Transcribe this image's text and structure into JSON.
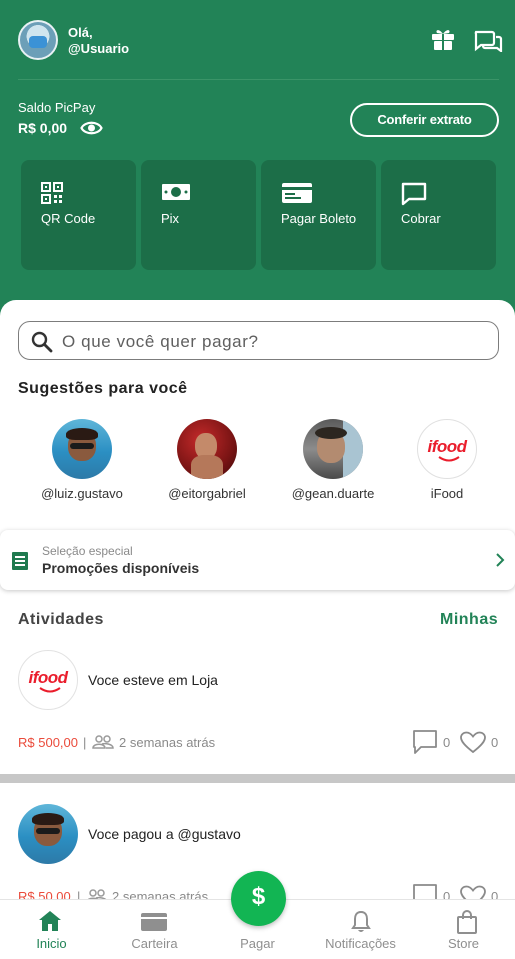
{
  "header": {
    "greeting": "Olá,",
    "username": "@Usuario",
    "balance_label": "Saldo PicPay",
    "balance_value": "R$ 0,00",
    "statement_button": "Conferir extrato",
    "icons": [
      "gift-icon",
      "chat-icon",
      "eye-icon"
    ]
  },
  "actions": [
    {
      "label": "QR Code",
      "icon": "qr-code-icon"
    },
    {
      "label": "Pix",
      "icon": "money-icon"
    },
    {
      "label": "Pagar Boleto",
      "icon": "boleto-icon"
    },
    {
      "label": "Cobrar",
      "icon": "message-icon"
    }
  ],
  "search": {
    "placeholder": "O que você quer pagar?"
  },
  "suggestions": {
    "title": "Sugestões para você",
    "items": [
      {
        "name": "@luiz.gustavo"
      },
      {
        "name": "@eitorgabriel"
      },
      {
        "name": "@gean.duarte"
      },
      {
        "name": "iFood",
        "logo_text": "ifood"
      }
    ]
  },
  "promo": {
    "subtitle": "Seleção especial",
    "title": "Promoções disponíveis"
  },
  "activities": {
    "title": "Atividades",
    "mine_link": "Minhas",
    "items": [
      {
        "logo_text": "ifood",
        "text": "Voce esteve em Loja",
        "amount": "R$ 500,00",
        "separator": "|",
        "time": "2 semanas atrás",
        "comments": "0",
        "likes": "0"
      },
      {
        "text": "Voce pagou a @gustavo",
        "amount": "R$ 50,00",
        "separator": "|",
        "time": "2 semanas atrás",
        "comments": "0",
        "likes": "0"
      }
    ]
  },
  "nav": {
    "items": [
      {
        "label": "Inicio",
        "icon": "home-icon",
        "active": true
      },
      {
        "label": "Carteira",
        "icon": "wallet-icon"
      },
      {
        "label": "Pagar",
        "icon": "dollar-icon"
      },
      {
        "label": "Notificações",
        "icon": "bell-icon"
      },
      {
        "label": "Store",
        "icon": "bag-icon"
      }
    ],
    "pay_symbol": "$"
  },
  "colors": {
    "brand": "#228357",
    "fab": "#12b553",
    "amount": "#ea4b3b",
    "ifood": "#ea1d2c"
  }
}
